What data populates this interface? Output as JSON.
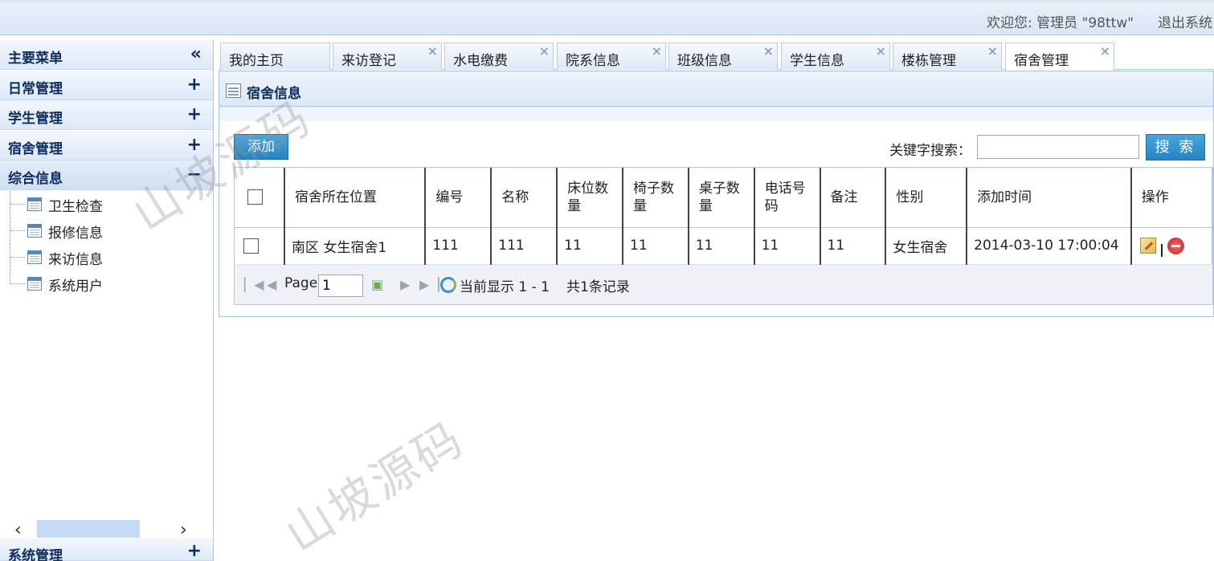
{
  "header": {
    "welcome": "欢迎您: 管理员 \"98ttw\"",
    "logout": "退出系统"
  },
  "sidebar": {
    "title": "主要菜单",
    "collapse_symbol": "«",
    "sections": [
      {
        "label": "日常管理",
        "symbol": "+"
      },
      {
        "label": "学生管理",
        "symbol": "+"
      },
      {
        "label": "宿舍管理",
        "symbol": "+"
      },
      {
        "label": "综合信息",
        "symbol": "−"
      }
    ],
    "tree_items": [
      "卫生检查",
      "报修信息",
      "来访信息",
      "系统用户"
    ],
    "bottom_section": {
      "label": "系统管理",
      "symbol": "+"
    },
    "scroll_left": "‹",
    "scroll_right": "›"
  },
  "tabs": [
    {
      "label": "我的主页",
      "closable": false
    },
    {
      "label": "来访登记",
      "closable": true
    },
    {
      "label": "水电缴费",
      "closable": true
    },
    {
      "label": "院系信息",
      "closable": true
    },
    {
      "label": "班级信息",
      "closable": true
    },
    {
      "label": "学生信息",
      "closable": true
    },
    {
      "label": "楼栋管理",
      "closable": true
    },
    {
      "label": "宿舍管理",
      "closable": true,
      "active": true
    }
  ],
  "tab_close_symbol": "×",
  "panel": {
    "title": "宿舍信息",
    "add_label": "添加",
    "search_label": "关键字搜索：",
    "search_value": "",
    "search_button": "搜 索"
  },
  "table": {
    "columns": [
      "宿舍所在位置",
      "编号",
      "名称",
      "床位数量",
      "椅子数量",
      "桌子数量",
      "电话号码",
      "备注",
      "性别",
      "添加时间",
      "操作"
    ],
    "rows": [
      [
        "南区 女生宿舍1",
        "111",
        "111",
        "11",
        "11",
        "11",
        "11",
        "11",
        "女生宿舍",
        "2014-03-10 17:00:04"
      ]
    ]
  },
  "pager": {
    "page_label": "Page",
    "page_value": "1",
    "display_text": "当前显示 1 - 1",
    "total_text": "共1条记录"
  },
  "watermark": "山坡源码",
  "colors": {
    "accent": "#2583c2",
    "header_bg": "#d9e6f5",
    "border": "#a8c3e4",
    "menu_text": "#0e2d5f"
  }
}
